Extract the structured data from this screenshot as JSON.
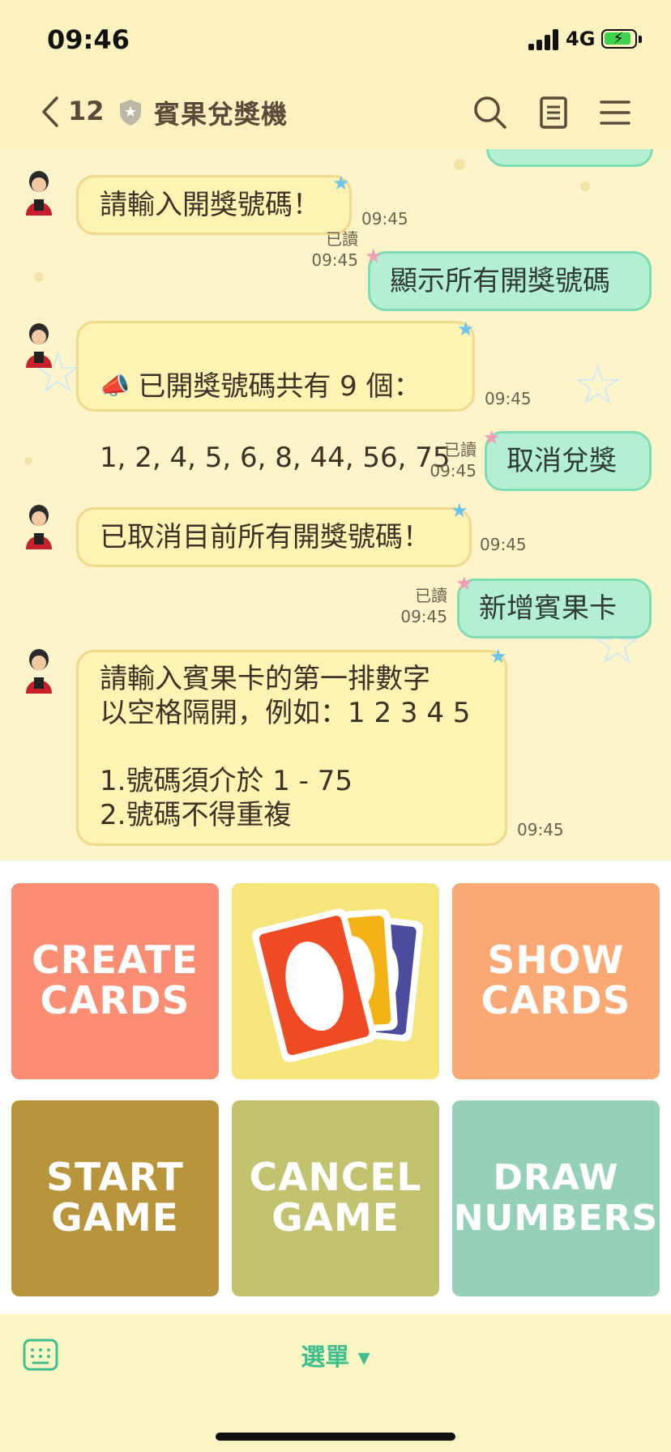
{
  "status_bar": {
    "time": "09:46",
    "network": "4G"
  },
  "header": {
    "back_count": "12",
    "title": "賓果兌獎機"
  },
  "messages": {
    "m1": {
      "text": "請輸入開獎號碼！",
      "time": "09:45"
    },
    "m2": {
      "text": "顯示所有開獎號碼",
      "read": "已讀",
      "time": "09:45"
    },
    "m3": {
      "line1": "已開獎號碼共有 9 個：",
      "line2": "1, 2, 4, 5, 6, 8, 44, 56, 75",
      "time": "09:45"
    },
    "m4": {
      "text": "取消兌獎",
      "read": "已讀",
      "time": "09:45"
    },
    "m5": {
      "text": "已取消目前所有開獎號碼！",
      "time": "09:45"
    },
    "m6": {
      "text": "新增賓果卡",
      "read": "已讀",
      "time": "09:45"
    },
    "m7": {
      "text": "請輸入賓果卡的第一排數字\n以空格隔開，例如：1 2 3 4 5\n\n1.號碼須介於 1 - 75\n2.號碼不得重複",
      "time": "09:45"
    }
  },
  "rich_menu": {
    "create_cards": "CREATE\nCARDS",
    "show_cards": "SHOW\nCARDS",
    "start_game": "START\nGAME",
    "cancel_game": "CANCEL\nGAME",
    "draw_numbers": "DRAW\nNUMBERS"
  },
  "bottom_bar": {
    "menu_label": "選單 ▾"
  },
  "colors": {
    "create_cards": "#fa8d72",
    "card_tile": "#f5e57a",
    "show_cards": "#fba874",
    "start_game": "#b8943a",
    "cancel_game": "#c3c26f",
    "draw_numbers": "#95d1b9"
  }
}
